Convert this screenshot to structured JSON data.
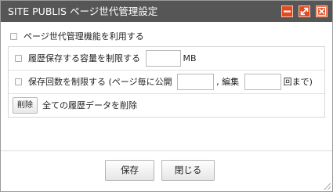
{
  "dialog": {
    "title": "SITE PUBLIS ページ世代管理設定",
    "window_buttons": {
      "minimize": "minimize-icon",
      "maximize": "maximize-icon",
      "close": "close-icon"
    }
  },
  "settings": {
    "enable_label": "ページ世代管理機能を利用する",
    "enable_checked": false,
    "capacity": {
      "label": "履歴保存する容量を制限する",
      "value": "",
      "unit": "MB",
      "checked": false
    },
    "count": {
      "label": "保存回数を制限する (ページ毎に公開",
      "publish_value": "",
      "separator": ", 編集",
      "edit_value": "",
      "suffix": "回まで)",
      "checked": false
    },
    "delete": {
      "button_label": "削除",
      "description": "全ての履歴データを削除"
    }
  },
  "footer": {
    "save_label": "保存",
    "close_label": "閉じる"
  },
  "colors": {
    "titlebar": "#565656",
    "window_button": "#e34a1f"
  }
}
